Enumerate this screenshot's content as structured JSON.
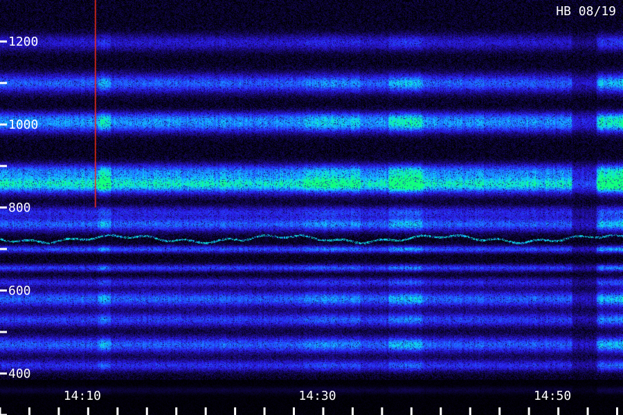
{
  "chart_data": {
    "type": "heatmap",
    "title": "HB 08/19",
    "xlabel": "",
    "ylabel": "",
    "x_ticks": [
      {
        "label": "14:10",
        "value": 850
      },
      {
        "label": "14:30",
        "value": 870
      },
      {
        "label": "14:50",
        "value": 890
      }
    ],
    "xlim": [
      843,
      896
    ],
    "x_minor_step": 2.5,
    "ylim": [
      300,
      1300
    ],
    "y_ticks": [
      {
        "label": "1200",
        "value": 1200
      },
      {
        "label": "1000",
        "value": 1000
      },
      {
        "label": "800",
        "value": 800
      },
      {
        "label": "600",
        "value": 600
      },
      {
        "label": "400",
        "value": 400
      }
    ],
    "y_minor_ticks": [
      1100,
      900,
      700,
      500,
      300
    ],
    "grid": false,
    "colormap": [
      "#000000",
      "#1a0a78",
      "#2a1ae8",
      "#2060ff",
      "#10d0ff",
      "#10ff80"
    ],
    "bands": [
      {
        "center": 1198,
        "width": 14,
        "intensity": 0.35
      },
      {
        "center": 1100,
        "width": 16,
        "intensity": 0.6
      },
      {
        "center": 1020,
        "width": 10,
        "intensity": 0.35
      },
      {
        "center": 1000,
        "width": 14,
        "intensity": 0.65
      },
      {
        "center": 890,
        "width": 12,
        "intensity": 0.55
      },
      {
        "center": 857,
        "width": 16,
        "intensity": 0.95
      },
      {
        "center": 790,
        "width": 10,
        "intensity": 0.4
      },
      {
        "center": 760,
        "width": 12,
        "intensity": 0.6
      },
      {
        "center": 700,
        "width": 6,
        "intensity": 0.55
      },
      {
        "center": 655,
        "width": 6,
        "intensity": 0.5
      },
      {
        "center": 620,
        "width": 8,
        "intensity": 0.4
      },
      {
        "center": 580,
        "width": 14,
        "intensity": 0.6
      },
      {
        "center": 530,
        "width": 12,
        "intensity": 0.5
      },
      {
        "center": 470,
        "width": 14,
        "intensity": 0.6
      },
      {
        "center": 420,
        "width": 10,
        "intensity": 0.45
      },
      {
        "center": 360,
        "width": 6,
        "intensity": 0.35
      }
    ]
  }
}
